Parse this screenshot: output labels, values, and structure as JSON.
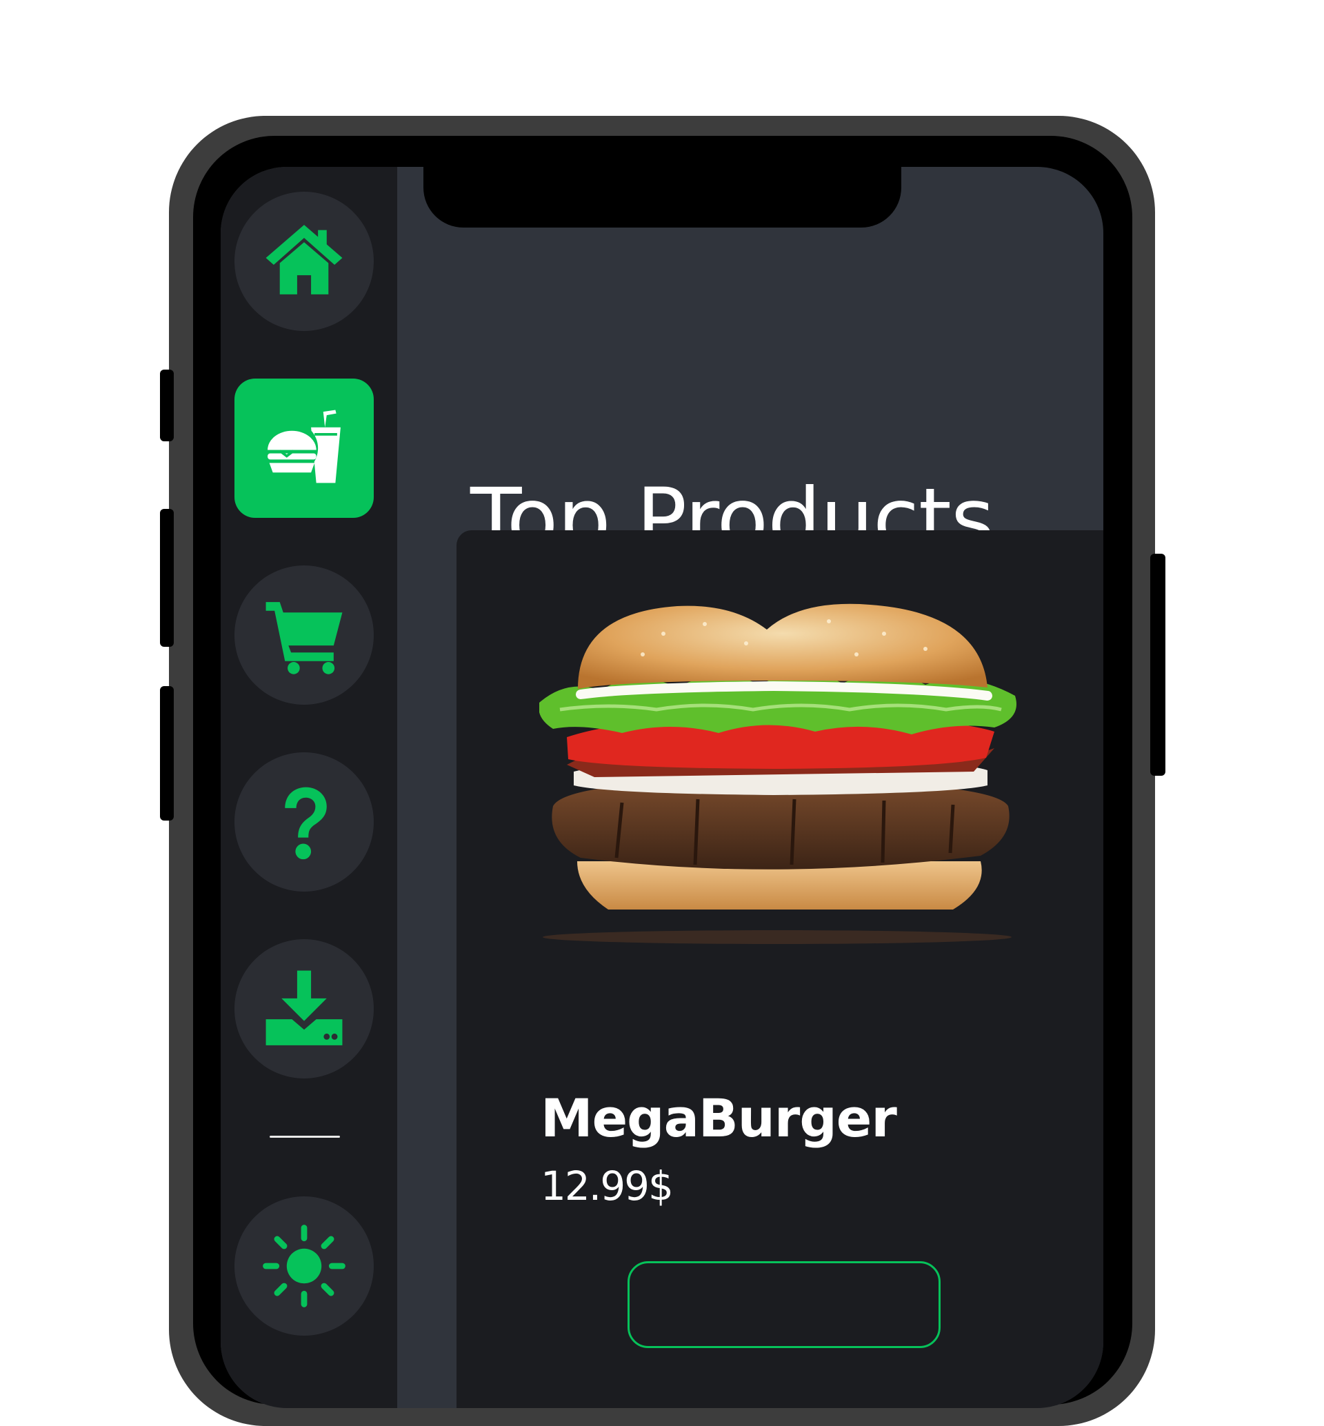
{
  "colors": {
    "accent": "#06c25a",
    "screen_bg": "#30343c",
    "panel_bg": "#1b1c20",
    "icon_circle_bg": "#2b2d33",
    "text": "#ffffff"
  },
  "sidebar": {
    "items": [
      {
        "icon": "home-icon",
        "active": false
      },
      {
        "icon": "burger-drink-icon",
        "active": true
      },
      {
        "icon": "cart-icon",
        "active": false
      },
      {
        "icon": "help-icon",
        "active": false
      },
      {
        "icon": "download-icon",
        "active": false
      },
      {
        "icon": "sun-icon",
        "active": false
      }
    ]
  },
  "main": {
    "title": "Top Products",
    "product": {
      "name": "MegaBurger",
      "price": "12.99$",
      "image": "burger-image"
    }
  }
}
